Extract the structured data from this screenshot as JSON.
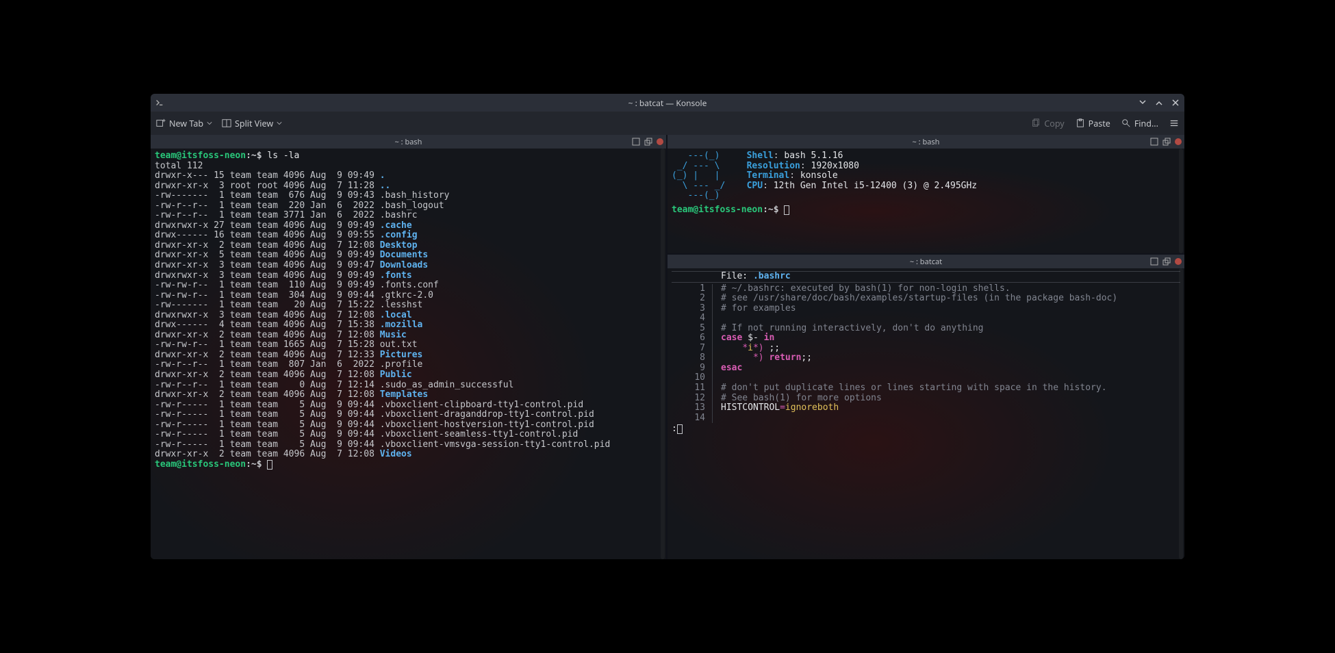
{
  "window": {
    "title": "~ : batcat — Konsole"
  },
  "toolbar": {
    "new_tab": "New Tab",
    "split_view": "Split View",
    "copy": "Copy",
    "paste": "Paste",
    "find": "Find..."
  },
  "panes": {
    "left": {
      "title": "~ : bash",
      "prompt_user": "team@itsfoss-neon",
      "prompt_path": "~",
      "command": "ls -la",
      "total": "total 112",
      "entries": [
        {
          "perm": "drwxr-x---",
          "ln": "15",
          "own": "team",
          "grp": "team",
          "size": "4096",
          "date": "Aug  9 09:49",
          "name": ".",
          "type": "dir"
        },
        {
          "perm": "drwxr-xr-x",
          "ln": " 3",
          "own": "root",
          "grp": "root",
          "size": "4096",
          "date": "Aug  7 11:28",
          "name": "..",
          "type": "dir"
        },
        {
          "perm": "-rw-------",
          "ln": " 1",
          "own": "team",
          "grp": "team",
          "size": " 676",
          "date": "Aug  9 09:43",
          "name": ".bash_history",
          "type": "file"
        },
        {
          "perm": "-rw-r--r--",
          "ln": " 1",
          "own": "team",
          "grp": "team",
          "size": " 220",
          "date": "Jan  6  2022",
          "name": ".bash_logout",
          "type": "file"
        },
        {
          "perm": "-rw-r--r--",
          "ln": " 1",
          "own": "team",
          "grp": "team",
          "size": "3771",
          "date": "Jan  6  2022",
          "name": ".bashrc",
          "type": "file"
        },
        {
          "perm": "drwxrwxr-x",
          "ln": "27",
          "own": "team",
          "grp": "team",
          "size": "4096",
          "date": "Aug  9 09:49",
          "name": ".cache",
          "type": "dir"
        },
        {
          "perm": "drwx------",
          "ln": "16",
          "own": "team",
          "grp": "team",
          "size": "4096",
          "date": "Aug  9 09:55",
          "name": ".config",
          "type": "dir"
        },
        {
          "perm": "drwxr-xr-x",
          "ln": " 2",
          "own": "team",
          "grp": "team",
          "size": "4096",
          "date": "Aug  7 12:08",
          "name": "Desktop",
          "type": "dir"
        },
        {
          "perm": "drwxr-xr-x",
          "ln": " 5",
          "own": "team",
          "grp": "team",
          "size": "4096",
          "date": "Aug  9 09:49",
          "name": "Documents",
          "type": "dir"
        },
        {
          "perm": "drwxr-xr-x",
          "ln": " 3",
          "own": "team",
          "grp": "team",
          "size": "4096",
          "date": "Aug  9 09:47",
          "name": "Downloads",
          "type": "dir"
        },
        {
          "perm": "drwxrwxr-x",
          "ln": " 3",
          "own": "team",
          "grp": "team",
          "size": "4096",
          "date": "Aug  9 09:49",
          "name": ".fonts",
          "type": "dir"
        },
        {
          "perm": "-rw-rw-r--",
          "ln": " 1",
          "own": "team",
          "grp": "team",
          "size": " 110",
          "date": "Aug  9 09:49",
          "name": ".fonts.conf",
          "type": "file"
        },
        {
          "perm": "-rw-rw-r--",
          "ln": " 1",
          "own": "team",
          "grp": "team",
          "size": " 304",
          "date": "Aug  9 09:44",
          "name": ".gtkrc-2.0",
          "type": "file"
        },
        {
          "perm": "-rw-------",
          "ln": " 1",
          "own": "team",
          "grp": "team",
          "size": "  20",
          "date": "Aug  7 15:22",
          "name": ".lesshst",
          "type": "file"
        },
        {
          "perm": "drwxrwxr-x",
          "ln": " 3",
          "own": "team",
          "grp": "team",
          "size": "4096",
          "date": "Aug  7 12:08",
          "name": ".local",
          "type": "dir"
        },
        {
          "perm": "drwx------",
          "ln": " 4",
          "own": "team",
          "grp": "team",
          "size": "4096",
          "date": "Aug  7 15:38",
          "name": ".mozilla",
          "type": "dir"
        },
        {
          "perm": "drwxr-xr-x",
          "ln": " 2",
          "own": "team",
          "grp": "team",
          "size": "4096",
          "date": "Aug  7 12:08",
          "name": "Music",
          "type": "dir"
        },
        {
          "perm": "-rw-rw-r--",
          "ln": " 1",
          "own": "team",
          "grp": "team",
          "size": "1665",
          "date": "Aug  7 15:28",
          "name": "out.txt",
          "type": "file"
        },
        {
          "perm": "drwxr-xr-x",
          "ln": " 2",
          "own": "team",
          "grp": "team",
          "size": "4096",
          "date": "Aug  7 12:33",
          "name": "Pictures",
          "type": "dir"
        },
        {
          "perm": "-rw-r--r--",
          "ln": " 1",
          "own": "team",
          "grp": "team",
          "size": " 807",
          "date": "Jan  6  2022",
          "name": ".profile",
          "type": "file"
        },
        {
          "perm": "drwxr-xr-x",
          "ln": " 2",
          "own": "team",
          "grp": "team",
          "size": "4096",
          "date": "Aug  7 12:08",
          "name": "Public",
          "type": "dir"
        },
        {
          "perm": "-rw-r--r--",
          "ln": " 1",
          "own": "team",
          "grp": "team",
          "size": "   0",
          "date": "Aug  7 12:14",
          "name": ".sudo_as_admin_successful",
          "type": "file"
        },
        {
          "perm": "drwxr-xr-x",
          "ln": " 2",
          "own": "team",
          "grp": "team",
          "size": "4096",
          "date": "Aug  7 12:08",
          "name": "Templates",
          "type": "dir"
        },
        {
          "perm": "-rw-r-----",
          "ln": " 1",
          "own": "team",
          "grp": "team",
          "size": "   5",
          "date": "Aug  9 09:44",
          "name": ".vboxclient-clipboard-tty1-control.pid",
          "type": "file"
        },
        {
          "perm": "-rw-r-----",
          "ln": " 1",
          "own": "team",
          "grp": "team",
          "size": "   5",
          "date": "Aug  9 09:44",
          "name": ".vboxclient-draganddrop-tty1-control.pid",
          "type": "file"
        },
        {
          "perm": "-rw-r-----",
          "ln": " 1",
          "own": "team",
          "grp": "team",
          "size": "   5",
          "date": "Aug  9 09:44",
          "name": ".vboxclient-hostversion-tty1-control.pid",
          "type": "file"
        },
        {
          "perm": "-rw-r-----",
          "ln": " 1",
          "own": "team",
          "grp": "team",
          "size": "   5",
          "date": "Aug  9 09:44",
          "name": ".vboxclient-seamless-tty1-control.pid",
          "type": "file"
        },
        {
          "perm": "-rw-r-----",
          "ln": " 1",
          "own": "team",
          "grp": "team",
          "size": "   5",
          "date": "Aug  9 09:44",
          "name": ".vboxclient-vmsvga-session-tty1-control.pid",
          "type": "file"
        },
        {
          "perm": "drwxr-xr-x",
          "ln": " 2",
          "own": "team",
          "grp": "team",
          "size": "4096",
          "date": "Aug  7 12:08",
          "name": "Videos",
          "type": "dir"
        }
      ]
    },
    "right_top": {
      "title": "~ : bash",
      "ascii": [
        "   ---(_)  ",
        " _/ --- \\  ",
        "(_) |   |  ",
        "  \\ --- _/ ",
        "   ---(_)  "
      ],
      "info": [
        {
          "k": "Shell",
          "v": "bash 5.1.16"
        },
        {
          "k": "Resolution",
          "v": "1920x1080"
        },
        {
          "k": "Terminal",
          "v": "konsole"
        },
        {
          "k": "CPU",
          "v": "12th Gen Intel i5-12400 (3) @ 2.495GHz"
        }
      ],
      "prompt_user": "team@itsfoss-neon",
      "prompt_path": "~"
    },
    "right_bot": {
      "title": "~ : batcat",
      "file_label": "File:",
      "file_name": ".bashrc",
      "lines": [
        {
          "n": 1,
          "type": "comment",
          "txt": "# ~/.bashrc: executed by bash(1) for non-login shells."
        },
        {
          "n": 2,
          "type": "comment",
          "txt": "# see /usr/share/doc/bash/examples/startup-files (in the package bash-doc)"
        },
        {
          "n": 3,
          "type": "comment",
          "txt": "# for examples"
        },
        {
          "n": 4,
          "type": "blank",
          "txt": ""
        },
        {
          "n": 5,
          "type": "comment",
          "txt": "# If not running interactively, don't do anything"
        },
        {
          "n": 6,
          "type": "case",
          "txt": "case $- in"
        },
        {
          "n": 7,
          "type": "case-arm1",
          "txt": "    *i*) ;;"
        },
        {
          "n": 8,
          "type": "case-arm2",
          "txt": "      *) return;;"
        },
        {
          "n": 9,
          "type": "esac",
          "txt": "esac"
        },
        {
          "n": 10,
          "type": "blank",
          "txt": ""
        },
        {
          "n": 11,
          "type": "comment",
          "txt": "# don't put duplicate lines or lines starting with space in the history."
        },
        {
          "n": 12,
          "type": "comment",
          "txt": "# See bash(1) for more options"
        },
        {
          "n": 13,
          "type": "assign",
          "txt": "HISTCONTROL=ignoreboth"
        },
        {
          "n": 14,
          "type": "blank",
          "txt": ""
        }
      ],
      "pager": ":"
    }
  }
}
